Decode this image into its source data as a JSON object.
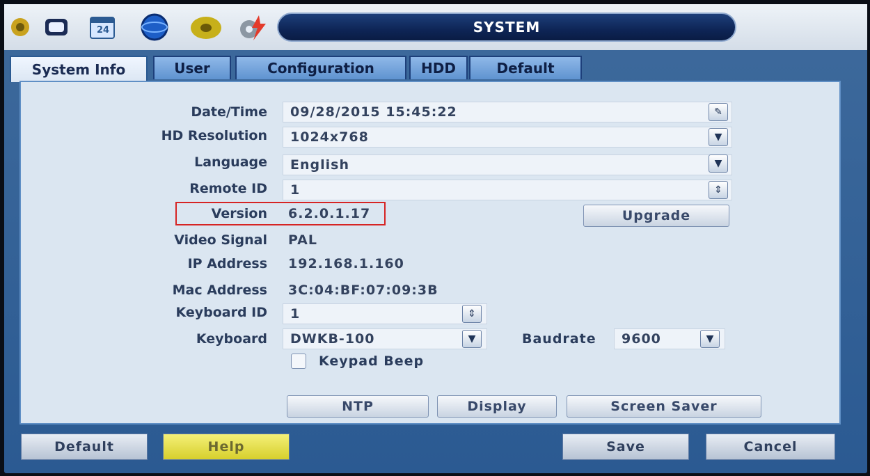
{
  "header": {
    "title": "SYSTEM",
    "icons": [
      "camera-icon",
      "monitor-icon",
      "calendar-icon",
      "network-globe-icon",
      "disk-icon",
      "system-gear-icon"
    ],
    "calendar_day": "24"
  },
  "tabs": [
    {
      "label": "System Info"
    },
    {
      "label": "User"
    },
    {
      "label": "Configuration"
    },
    {
      "label": "HDD"
    },
    {
      "label": "Default"
    }
  ],
  "form": {
    "datetime_label": "Date/Time",
    "datetime_value": "09/28/2015 15:45:22",
    "hd_resolution_label": "HD Resolution",
    "hd_resolution_value": "1024x768",
    "language_label": "Language",
    "language_value": "English",
    "remote_id_label": "Remote ID",
    "remote_id_value": "1",
    "version_label": "Version",
    "version_value": "6.2.0.1.17",
    "upgrade_label": "Upgrade",
    "video_signal_label": "Video Signal",
    "video_signal_value": "PAL",
    "ip_label": "IP Address",
    "ip_value": "192.168.1.160",
    "mac_label": "Mac Address",
    "mac_value": "3C:04:BF:07:09:3B",
    "keyboard_id_label": "Keyboard ID",
    "keyboard_id_value": "1",
    "keyboard_label": "Keyboard",
    "keyboard_value": "DWKB-100",
    "baudrate_label": "Baudrate",
    "baudrate_value": "9600",
    "keypad_beep_label": "Keypad Beep",
    "ntp_label": "NTP",
    "display_label": "Display",
    "screen_saver_label": "Screen Saver"
  },
  "footer": {
    "default_label": "Default",
    "help_label": "Help",
    "save_label": "Save",
    "cancel_label": "Cancel"
  }
}
